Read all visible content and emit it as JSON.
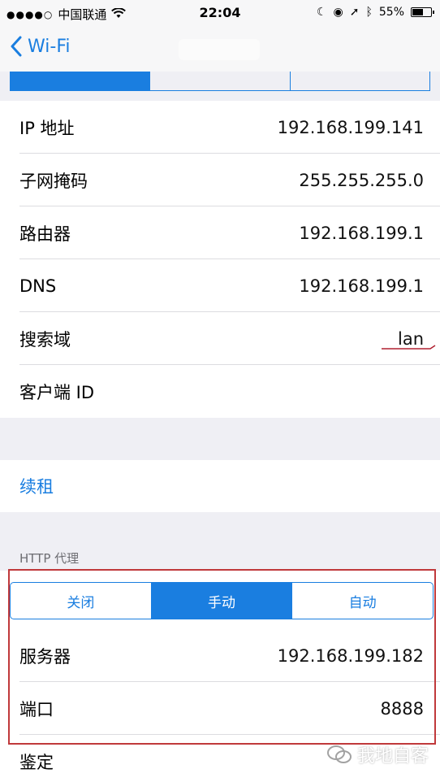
{
  "status_bar": {
    "carrier": "中国联通",
    "time": "22:04",
    "battery": "55%",
    "battery_level": 0.55
  },
  "nav": {
    "back_label": "Wi-Fi"
  },
  "dhcp_rows": [
    {
      "label": "IP 地址",
      "value": "192.168.199.141"
    },
    {
      "label": "子网掩码",
      "value": "255.255.255.0"
    },
    {
      "label": "路由器",
      "value": "192.168.199.1"
    },
    {
      "label": "DNS",
      "value": "192.168.199.1"
    },
    {
      "label": "搜索域",
      "value": "lan"
    },
    {
      "label": "客户端 ID",
      "value": ""
    }
  ],
  "renew_label": "续租",
  "http_proxy": {
    "header": "HTTP 代理",
    "segments": [
      "关闭",
      "手动",
      "自动"
    ],
    "selected": "手动",
    "rows": [
      {
        "label": "服务器",
        "value": "192.168.199.182"
      },
      {
        "label": "端口",
        "value": "8888"
      },
      {
        "label": "鉴定",
        "value": ""
      }
    ]
  },
  "watermark": "我地自客",
  "colors": {
    "accent": "#1a7ee0",
    "highlight_border": "#c0393b"
  }
}
